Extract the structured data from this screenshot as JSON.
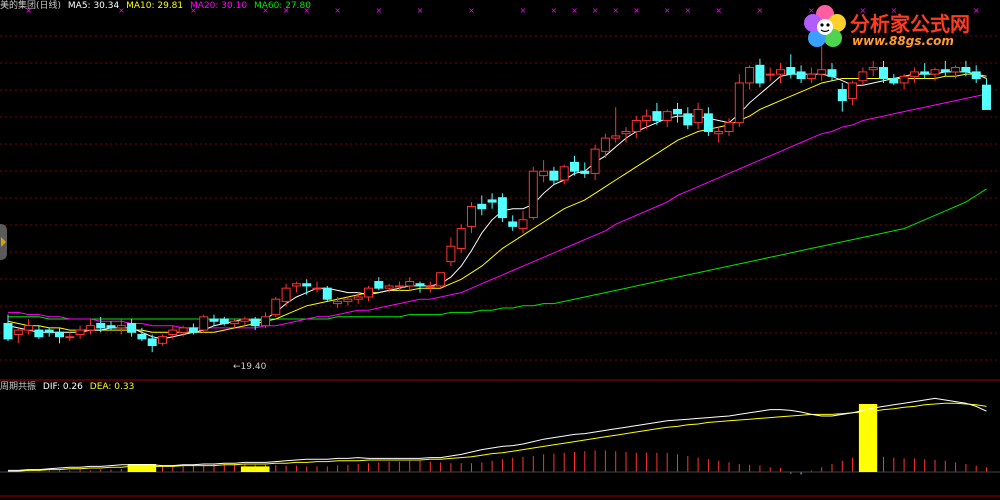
{
  "legend": {
    "title": "美的集团(日线)",
    "ma5_label": "MA5: 30.34",
    "ma10_label": "MA10: 29.81",
    "ma20_label": "MA20: 30.10",
    "ma60_label": "MA60: 27.80"
  },
  "indicator_legend": {
    "name": "周期共振",
    "dif_label": "DIF: 0.26",
    "dea_label": "DEA: 0.33"
  },
  "low_marker": "19.40",
  "logo": {
    "text": "分析家公式网",
    "url": "www.88gs.com"
  },
  "colors": {
    "up": "#ff3232",
    "down": "#54ffff",
    "ma5": "#ffffff",
    "ma10": "#ffff00",
    "ma20": "#ff00ff",
    "ma60": "#00e600",
    "grid": "#800000",
    "marker": "#ff00ff"
  },
  "chart_data": {
    "type": "candlestick",
    "price_range": [
      18.5,
      34.0
    ],
    "ohlc": [
      [
        20.7,
        21.1,
        19.9,
        20.0
      ],
      [
        20.2,
        20.5,
        19.8,
        20.4
      ],
      [
        20.4,
        20.9,
        20.2,
        20.6
      ],
      [
        20.4,
        20.6,
        20.0,
        20.1
      ],
      [
        20.4,
        20.5,
        20.1,
        20.3
      ],
      [
        20.3,
        20.5,
        19.8,
        20.1
      ],
      [
        20.1,
        20.3,
        19.9,
        20.1
      ],
      [
        20.2,
        20.6,
        20.0,
        20.4
      ],
      [
        20.4,
        20.9,
        20.2,
        20.6
      ],
      [
        20.7,
        21.0,
        20.3,
        20.5
      ],
      [
        20.6,
        20.8,
        20.4,
        20.5
      ],
      [
        20.5,
        20.9,
        20.2,
        20.6
      ],
      [
        20.7,
        20.9,
        20.1,
        20.3
      ],
      [
        20.2,
        20.5,
        19.9,
        20.0
      ],
      [
        20.0,
        20.2,
        19.4,
        19.7
      ],
      [
        19.8,
        20.2,
        19.7,
        20.1
      ],
      [
        20.2,
        20.6,
        20.0,
        20.4
      ],
      [
        20.3,
        20.6,
        20.1,
        20.5
      ],
      [
        20.5,
        20.7,
        20.2,
        20.3
      ],
      [
        20.4,
        21.1,
        20.3,
        21.0
      ],
      [
        20.9,
        21.1,
        20.6,
        20.8
      ],
      [
        20.9,
        21.0,
        20.6,
        20.7
      ],
      [
        20.7,
        20.9,
        20.5,
        20.8
      ],
      [
        20.8,
        21.0,
        20.6,
        20.9
      ],
      [
        20.9,
        21.0,
        20.4,
        20.6
      ],
      [
        20.6,
        21.2,
        20.5,
        21.0
      ],
      [
        21.1,
        21.9,
        21.0,
        21.8
      ],
      [
        21.7,
        22.5,
        21.5,
        22.3
      ],
      [
        22.4,
        22.6,
        22.1,
        22.5
      ],
      [
        22.5,
        22.7,
        22.0,
        22.4
      ],
      [
        22.3,
        22.6,
        22.1,
        22.3
      ],
      [
        22.3,
        22.4,
        21.7,
        21.8
      ],
      [
        21.6,
        21.9,
        21.4,
        21.7
      ],
      [
        21.7,
        21.9,
        21.5,
        21.8
      ],
      [
        21.8,
        22.1,
        21.6,
        21.9
      ],
      [
        21.9,
        22.4,
        21.7,
        22.3
      ],
      [
        22.6,
        22.8,
        22.2,
        22.3
      ],
      [
        22.3,
        22.5,
        22.1,
        22.4
      ],
      [
        22.4,
        22.6,
        22.2,
        22.4
      ],
      [
        22.4,
        22.8,
        22.2,
        22.6
      ],
      [
        22.5,
        22.6,
        22.1,
        22.4
      ],
      [
        22.4,
        22.6,
        22.1,
        22.4
      ],
      [
        22.4,
        23.0,
        22.3,
        23.0
      ],
      [
        23.5,
        24.6,
        23.3,
        24.2
      ],
      [
        24.1,
        25.2,
        23.9,
        25.0
      ],
      [
        25.1,
        26.2,
        24.8,
        26.0
      ],
      [
        26.1,
        26.5,
        25.6,
        25.9
      ],
      [
        26.3,
        26.6,
        25.9,
        26.2
      ],
      [
        26.4,
        26.6,
        25.3,
        25.5
      ],
      [
        25.3,
        25.6,
        24.9,
        25.1
      ],
      [
        25.0,
        25.8,
        24.8,
        25.4
      ],
      [
        25.5,
        27.8,
        25.4,
        27.6
      ],
      [
        27.4,
        28.1,
        27.1,
        27.6
      ],
      [
        27.6,
        27.8,
        27.0,
        27.2
      ],
      [
        27.2,
        27.9,
        27.0,
        27.8
      ],
      [
        28.0,
        28.3,
        27.4,
        27.6
      ],
      [
        27.6,
        28.0,
        27.3,
        27.5
      ],
      [
        27.5,
        28.8,
        27.2,
        28.6
      ],
      [
        28.5,
        29.3,
        28.2,
        29.1
      ],
      [
        29.1,
        30.5,
        28.9,
        29.2
      ],
      [
        29.3,
        29.6,
        28.9,
        29.4
      ],
      [
        29.4,
        30.1,
        29.1,
        29.9
      ],
      [
        29.9,
        30.4,
        29.5,
        30.1
      ],
      [
        30.3,
        30.7,
        29.7,
        29.9
      ],
      [
        29.9,
        30.4,
        29.6,
        30.3
      ],
      [
        30.4,
        30.7,
        29.8,
        30.2
      ],
      [
        30.2,
        30.5,
        29.5,
        29.7
      ],
      [
        29.8,
        30.7,
        29.5,
        30.4
      ],
      [
        30.2,
        30.5,
        29.2,
        29.4
      ],
      [
        29.3,
        29.6,
        28.9,
        29.4
      ],
      [
        29.4,
        30.0,
        29.2,
        29.8
      ],
      [
        29.8,
        32.0,
        29.6,
        31.6
      ],
      [
        31.6,
        32.4,
        31.3,
        32.3
      ],
      [
        32.4,
        32.7,
        31.4,
        31.6
      ],
      [
        32.0,
        32.3,
        31.7,
        32.0
      ],
      [
        32.0,
        32.5,
        31.6,
        32.2
      ],
      [
        32.3,
        32.9,
        31.8,
        32.0
      ],
      [
        32.1,
        32.4,
        31.6,
        31.8
      ],
      [
        31.8,
        32.3,
        31.6,
        32.0
      ],
      [
        32.0,
        33.8,
        31.7,
        32.2
      ],
      [
        32.2,
        32.5,
        31.7,
        31.9
      ],
      [
        31.3,
        31.6,
        30.3,
        30.8
      ],
      [
        30.9,
        31.7,
        30.6,
        31.6
      ],
      [
        31.7,
        32.3,
        31.5,
        32.1
      ],
      [
        32.2,
        32.6,
        31.9,
        32.3
      ],
      [
        32.3,
        32.6,
        31.6,
        31.8
      ],
      [
        31.8,
        32.0,
        31.5,
        31.6
      ],
      [
        31.6,
        32.0,
        31.3,
        31.9
      ],
      [
        31.9,
        32.3,
        31.6,
        32.1
      ],
      [
        32.1,
        32.5,
        31.8,
        32.0
      ],
      [
        32.0,
        32.3,
        31.7,
        32.2
      ],
      [
        32.2,
        32.6,
        31.9,
        32.1
      ],
      [
        32.1,
        32.4,
        31.8,
        32.3
      ],
      [
        32.3,
        32.6,
        31.9,
        32.1
      ],
      [
        32.1,
        32.4,
        31.6,
        31.8
      ],
      [
        31.5,
        31.8,
        30.5,
        30.4
      ]
    ],
    "ma5": [
      20.6,
      20.5,
      20.4,
      20.3,
      20.3,
      20.3,
      20.3,
      20.3,
      20.4,
      20.4,
      20.5,
      20.5,
      20.5,
      20.3,
      20.1,
      20.0,
      20.1,
      20.2,
      20.3,
      20.4,
      20.6,
      20.7,
      20.8,
      20.9,
      20.8,
      20.9,
      21.2,
      21.6,
      21.9,
      22.1,
      22.3,
      22.3,
      22.2,
      22.1,
      22.1,
      22.0,
      22.1,
      22.2,
      22.3,
      22.4,
      22.4,
      22.4,
      22.5,
      22.8,
      23.3,
      24.0,
      24.8,
      25.4,
      25.8,
      25.9,
      25.9,
      26.1,
      26.6,
      27.0,
      27.2,
      27.5,
      27.6,
      28.0,
      28.3,
      28.7,
      29.1,
      29.4,
      29.6,
      29.8,
      30.0,
      30.1,
      30.1,
      30.1,
      30.0,
      29.9,
      29.8,
      30.2,
      30.7,
      31.1,
      31.5,
      31.9,
      32.0,
      32.0,
      32.0,
      32.0,
      31.9,
      31.7,
      31.5,
      31.5,
      31.6,
      31.7,
      31.8,
      31.9,
      32.0,
      32.0,
      32.0,
      32.1,
      32.1,
      32.1,
      32.0,
      31.8
    ],
    "ma10": [
      20.8,
      20.7,
      20.6,
      20.6,
      20.5,
      20.5,
      20.4,
      20.4,
      20.4,
      20.4,
      20.4,
      20.4,
      20.4,
      20.4,
      20.3,
      20.3,
      20.3,
      20.3,
      20.3,
      20.3,
      20.3,
      20.4,
      20.5,
      20.6,
      20.7,
      20.8,
      20.9,
      21.1,
      21.3,
      21.5,
      21.6,
      21.7,
      21.8,
      21.9,
      22.0,
      22.1,
      22.1,
      22.2,
      22.2,
      22.2,
      22.3,
      22.3,
      22.3,
      22.5,
      22.7,
      23.0,
      23.3,
      23.7,
      24.1,
      24.4,
      24.7,
      25.0,
      25.3,
      25.6,
      25.9,
      26.1,
      26.3,
      26.6,
      26.9,
      27.2,
      27.5,
      27.8,
      28.1,
      28.4,
      28.7,
      29.0,
      29.2,
      29.4,
      29.5,
      29.6,
      29.7,
      29.9,
      30.1,
      30.4,
      30.6,
      30.8,
      31.0,
      31.2,
      31.4,
      31.6,
      31.7,
      31.8,
      31.8,
      31.8,
      31.8,
      31.8,
      31.8,
      31.8,
      31.8,
      31.8,
      31.8,
      31.9,
      31.9,
      32.0,
      32.0,
      31.9
    ],
    "ma20": [
      21.2,
      21.2,
      21.1,
      21.1,
      21.0,
      21.0,
      20.9,
      20.9,
      20.9,
      20.8,
      20.8,
      20.8,
      20.7,
      20.7,
      20.6,
      20.6,
      20.6,
      20.5,
      20.5,
      20.5,
      20.5,
      20.5,
      20.5,
      20.5,
      20.5,
      20.6,
      20.6,
      20.7,
      20.8,
      20.9,
      21.0,
      21.0,
      21.1,
      21.2,
      21.3,
      21.3,
      21.4,
      21.5,
      21.6,
      21.7,
      21.8,
      21.8,
      21.9,
      22.0,
      22.1,
      22.3,
      22.5,
      22.7,
      22.9,
      23.1,
      23.3,
      23.5,
      23.7,
      23.9,
      24.1,
      24.3,
      24.5,
      24.7,
      24.9,
      25.2,
      25.4,
      25.6,
      25.8,
      26.0,
      26.2,
      26.5,
      26.7,
      26.9,
      27.1,
      27.3,
      27.5,
      27.7,
      27.9,
      28.1,
      28.3,
      28.5,
      28.7,
      28.9,
      29.1,
      29.3,
      29.4,
      29.6,
      29.7,
      29.9,
      30.0,
      30.1,
      30.2,
      30.3,
      30.4,
      30.5,
      30.6,
      30.7,
      30.8,
      30.9,
      31.0,
      31.1
    ],
    "ma60": [
      21.0,
      21.0,
      21.0,
      21.0,
      20.9,
      20.9,
      20.9,
      20.9,
      20.9,
      20.9,
      20.9,
      20.9,
      20.9,
      20.9,
      20.9,
      20.9,
      20.9,
      20.9,
      20.9,
      20.9,
      20.9,
      20.9,
      20.9,
      20.9,
      20.9,
      20.9,
      20.9,
      20.9,
      20.9,
      20.9,
      20.9,
      20.9,
      21.0,
      21.0,
      21.0,
      21.0,
      21.0,
      21.0,
      21.0,
      21.1,
      21.1,
      21.1,
      21.1,
      21.2,
      21.2,
      21.2,
      21.3,
      21.3,
      21.4,
      21.4,
      21.5,
      21.5,
      21.6,
      21.6,
      21.7,
      21.8,
      21.9,
      22.0,
      22.1,
      22.2,
      22.3,
      22.4,
      22.5,
      22.6,
      22.7,
      22.8,
      22.9,
      23.0,
      23.1,
      23.2,
      23.3,
      23.4,
      23.5,
      23.6,
      23.7,
      23.8,
      23.9,
      24.0,
      24.1,
      24.2,
      24.3,
      24.4,
      24.5,
      24.6,
      24.7,
      24.8,
      24.9,
      25.0,
      25.2,
      25.4,
      25.6,
      25.8,
      26.0,
      26.2,
      26.5,
      26.8
    ],
    "low_annotation": {
      "index": 14,
      "value": 19.4
    },
    "signal_marks": [
      2,
      11,
      18,
      25,
      27,
      29,
      32,
      36,
      40,
      45,
      50,
      53,
      55,
      57,
      59,
      61,
      64,
      66,
      69,
      73,
      78,
      83,
      86,
      94
    ],
    "indicator": {
      "range": [
        -0.1,
        1.0
      ],
      "dif": [
        0.02,
        0.02,
        0.03,
        0.03,
        0.04,
        0.05,
        0.06,
        0.06,
        0.07,
        0.07,
        0.08,
        0.09,
        0.09,
        0.09,
        0.09,
        0.08,
        0.08,
        0.09,
        0.09,
        0.1,
        0.1,
        0.11,
        0.11,
        0.12,
        0.12,
        0.12,
        0.13,
        0.14,
        0.15,
        0.16,
        0.16,
        0.16,
        0.17,
        0.17,
        0.18,
        0.17,
        0.17,
        0.17,
        0.17,
        0.17,
        0.17,
        0.18,
        0.18,
        0.2,
        0.22,
        0.25,
        0.28,
        0.3,
        0.32,
        0.33,
        0.35,
        0.38,
        0.41,
        0.43,
        0.45,
        0.47,
        0.48,
        0.5,
        0.52,
        0.54,
        0.56,
        0.58,
        0.6,
        0.62,
        0.64,
        0.65,
        0.66,
        0.67,
        0.68,
        0.69,
        0.7,
        0.72,
        0.74,
        0.76,
        0.78,
        0.78,
        0.77,
        0.75,
        0.72,
        0.7,
        0.7,
        0.72,
        0.74,
        0.77,
        0.8,
        0.82,
        0.84,
        0.86,
        0.88,
        0.9,
        0.92,
        0.9,
        0.88,
        0.86,
        0.82,
        0.76
      ],
      "dea": [
        0.01,
        0.01,
        0.02,
        0.02,
        0.03,
        0.03,
        0.04,
        0.04,
        0.05,
        0.05,
        0.06,
        0.06,
        0.07,
        0.07,
        0.07,
        0.07,
        0.07,
        0.08,
        0.08,
        0.08,
        0.08,
        0.09,
        0.09,
        0.1,
        0.1,
        0.1,
        0.11,
        0.11,
        0.12,
        0.12,
        0.13,
        0.13,
        0.14,
        0.14,
        0.14,
        0.15,
        0.15,
        0.15,
        0.15,
        0.15,
        0.15,
        0.16,
        0.16,
        0.17,
        0.18,
        0.19,
        0.21,
        0.23,
        0.24,
        0.26,
        0.28,
        0.3,
        0.32,
        0.34,
        0.36,
        0.38,
        0.4,
        0.42,
        0.44,
        0.46,
        0.48,
        0.5,
        0.52,
        0.54,
        0.56,
        0.57,
        0.59,
        0.6,
        0.62,
        0.63,
        0.64,
        0.65,
        0.66,
        0.67,
        0.68,
        0.69,
        0.7,
        0.71,
        0.72,
        0.72,
        0.72,
        0.73,
        0.74,
        0.75,
        0.76,
        0.78,
        0.79,
        0.81,
        0.82,
        0.84,
        0.85,
        0.86,
        0.86,
        0.85,
        0.84,
        0.82
      ],
      "hist": [
        0.01,
        0.01,
        0.01,
        0.01,
        0.02,
        0.02,
        0.02,
        0.03,
        0.02,
        0.03,
        0.03,
        0.04,
        0.04,
        0.05,
        0.06,
        0.07,
        0.07,
        0.08,
        0.09,
        0.09,
        0.1,
        0.1,
        0.1,
        0.1,
        0.09,
        0.09,
        0.09,
        0.08,
        0.08,
        0.07,
        0.07,
        0.07,
        0.08,
        0.09,
        0.1,
        0.11,
        0.12,
        0.13,
        0.13,
        0.14,
        0.14,
        0.13,
        0.12,
        0.11,
        0.11,
        0.11,
        0.12,
        0.14,
        0.16,
        0.18,
        0.19,
        0.2,
        0.22,
        0.23,
        0.24,
        0.25,
        0.26,
        0.27,
        0.27,
        0.26,
        0.25,
        0.24,
        0.24,
        0.24,
        0.24,
        0.22,
        0.2,
        0.18,
        0.16,
        0.14,
        0.12,
        0.1,
        0.09,
        0.08,
        0.06,
        0.05,
        -0.02,
        -0.03,
        0.02,
        0.06,
        0.1,
        0.14,
        0.18,
        0.2,
        0.2,
        0.19,
        0.18,
        0.17,
        0.17,
        0.16,
        0.15,
        0.14,
        0.12,
        0.1,
        0.08,
        0.06
      ],
      "yellow_bars": [
        {
          "from": 12,
          "to": 14,
          "value": 0.1
        },
        {
          "from": 23,
          "to": 25,
          "value": 0.07
        },
        {
          "from": 83,
          "to": 84,
          "value": 0.85
        }
      ]
    }
  }
}
